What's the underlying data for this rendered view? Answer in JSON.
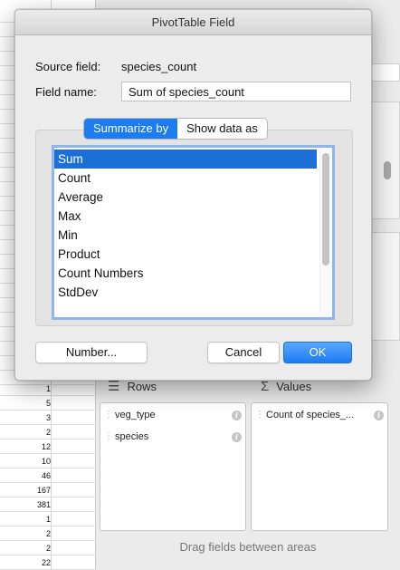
{
  "sheet": {
    "row_values": [
      "1",
      "5",
      "3",
      "2",
      "12",
      "10",
      "46",
      "167",
      "381",
      "1",
      "2",
      "2",
      "22"
    ]
  },
  "pane": {
    "rows_area": {
      "title": "Rows",
      "fields": [
        {
          "label": "veg_type"
        },
        {
          "label": "species"
        }
      ]
    },
    "values_area": {
      "title": "Values",
      "fields": [
        {
          "label": "Count of species_..."
        }
      ]
    },
    "drag_hint": "Drag fields between areas"
  },
  "dialog": {
    "title": "PivotTable Field",
    "source_field_label": "Source field:",
    "source_field_value": "species_count",
    "field_name_label": "Field name:",
    "field_name_value": "Sum of species_count",
    "tabs": [
      {
        "label": "Summarize by",
        "active": true
      },
      {
        "label": "Show data as",
        "active": false
      }
    ],
    "functions": [
      "Sum",
      "Count",
      "Average",
      "Max",
      "Min",
      "Product",
      "Count Numbers",
      "StdDev"
    ],
    "selected_function": "Sum",
    "buttons": {
      "number": "Number...",
      "cancel": "Cancel",
      "ok": "OK"
    }
  },
  "colors": {
    "accent": "#1c7df2",
    "selection": "#1d6fd8",
    "dialog_bg": "#ececec"
  },
  "icons": {
    "rows": "rows-lines-icon",
    "values": "sigma-icon",
    "info": "info-icon",
    "handle": "drag-handle-icon"
  }
}
